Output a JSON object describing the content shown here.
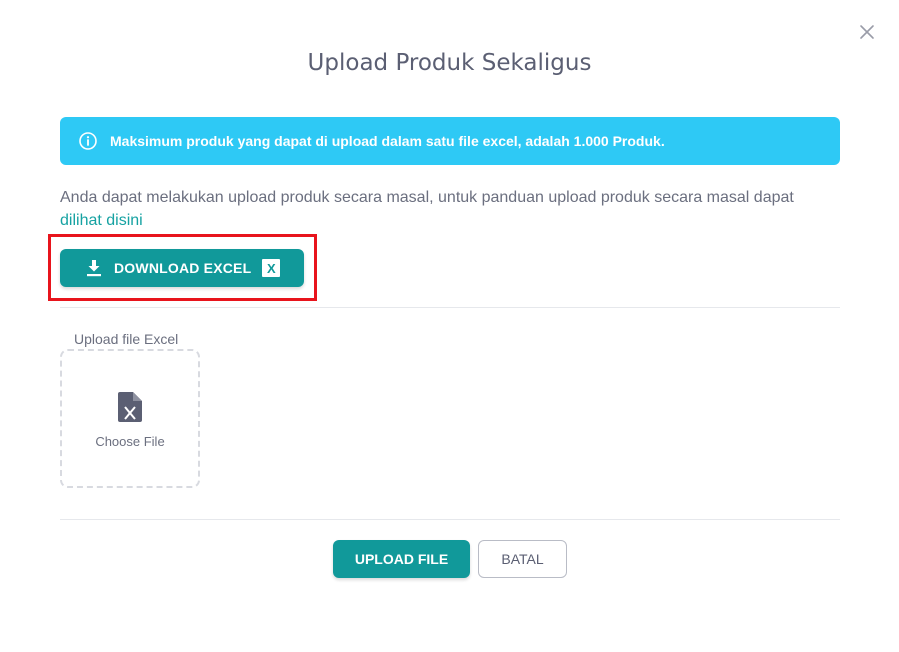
{
  "modal": {
    "title": "Upload Produk Sekaligus",
    "close_icon": "close-icon"
  },
  "alert": {
    "icon": "info-icon",
    "text": "Maksimum produk yang dapat di upload dalam satu file excel, adalah 1.000 Produk.",
    "color": "#2ec9f5"
  },
  "description": {
    "text": "Anda dapat melakukan upload produk secara masal, untuk panduan upload produk secara masal dapat ",
    "link_text": "dilihat disini"
  },
  "download": {
    "label": "DOWNLOAD EXCEL",
    "icon": "download-icon",
    "badge": "X",
    "color": "#11999a"
  },
  "upload": {
    "label": "Upload file Excel",
    "dropzone_text": "Choose File",
    "icon": "excel-file-icon"
  },
  "footer": {
    "upload_label": "UPLOAD FILE",
    "cancel_label": "BATAL"
  },
  "colors": {
    "primary": "#11999a",
    "highlight": "#e8141c"
  }
}
